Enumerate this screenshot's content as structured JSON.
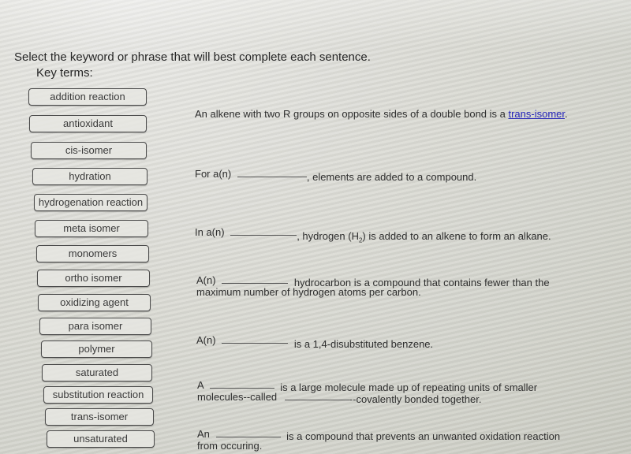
{
  "instructions": "Select the keyword or phrase that will best complete each sentence.",
  "key_terms_label": "Key terms:",
  "terms": [
    "addition reaction",
    "antioxidant",
    "cis-isomer",
    "hydration",
    "hydrogenation reaction",
    "meta isomer",
    "monomers",
    "ortho isomer",
    "oxidizing agent",
    "para isomer",
    "polymer",
    "saturated",
    "substitution reaction",
    "trans-isomer",
    "unsaturated"
  ],
  "sentences": {
    "s1": {
      "before": "An alkene with two R groups on opposite sides of a double bond is a ",
      "answer": "trans-isomer",
      "after": "."
    },
    "s2": {
      "before": "For a(n)",
      "after": ", elements are added to a compound."
    },
    "s3": {
      "before": "In a(n)",
      "after_a": ", hydrogen (H",
      "sub": "2",
      "after_b": ") is added to an alkene to form an alkane."
    },
    "s4": {
      "before": "A(n)",
      "after_line1": "hydrocarbon is a compound that contains fewer than the",
      "line2": "maximum number of hydrogen atoms per carbon."
    },
    "s5": {
      "before": "A(n)",
      "after": "is a 1,4-disubstituted benzene."
    },
    "s6": {
      "before": "A",
      "after_line1": "is a large molecule made up of repeating units of smaller",
      "line2_before": "molecules--called",
      "line2_after": "--covalently bonded together."
    },
    "s7": {
      "before": "An",
      "after_line1": "is a compound that prevents an unwanted oxidation reaction",
      "line2": "from occuring."
    }
  },
  "colors": {
    "link": "#2424b8",
    "text": "#2e2e2e",
    "term_border": "#4a4a4a"
  }
}
